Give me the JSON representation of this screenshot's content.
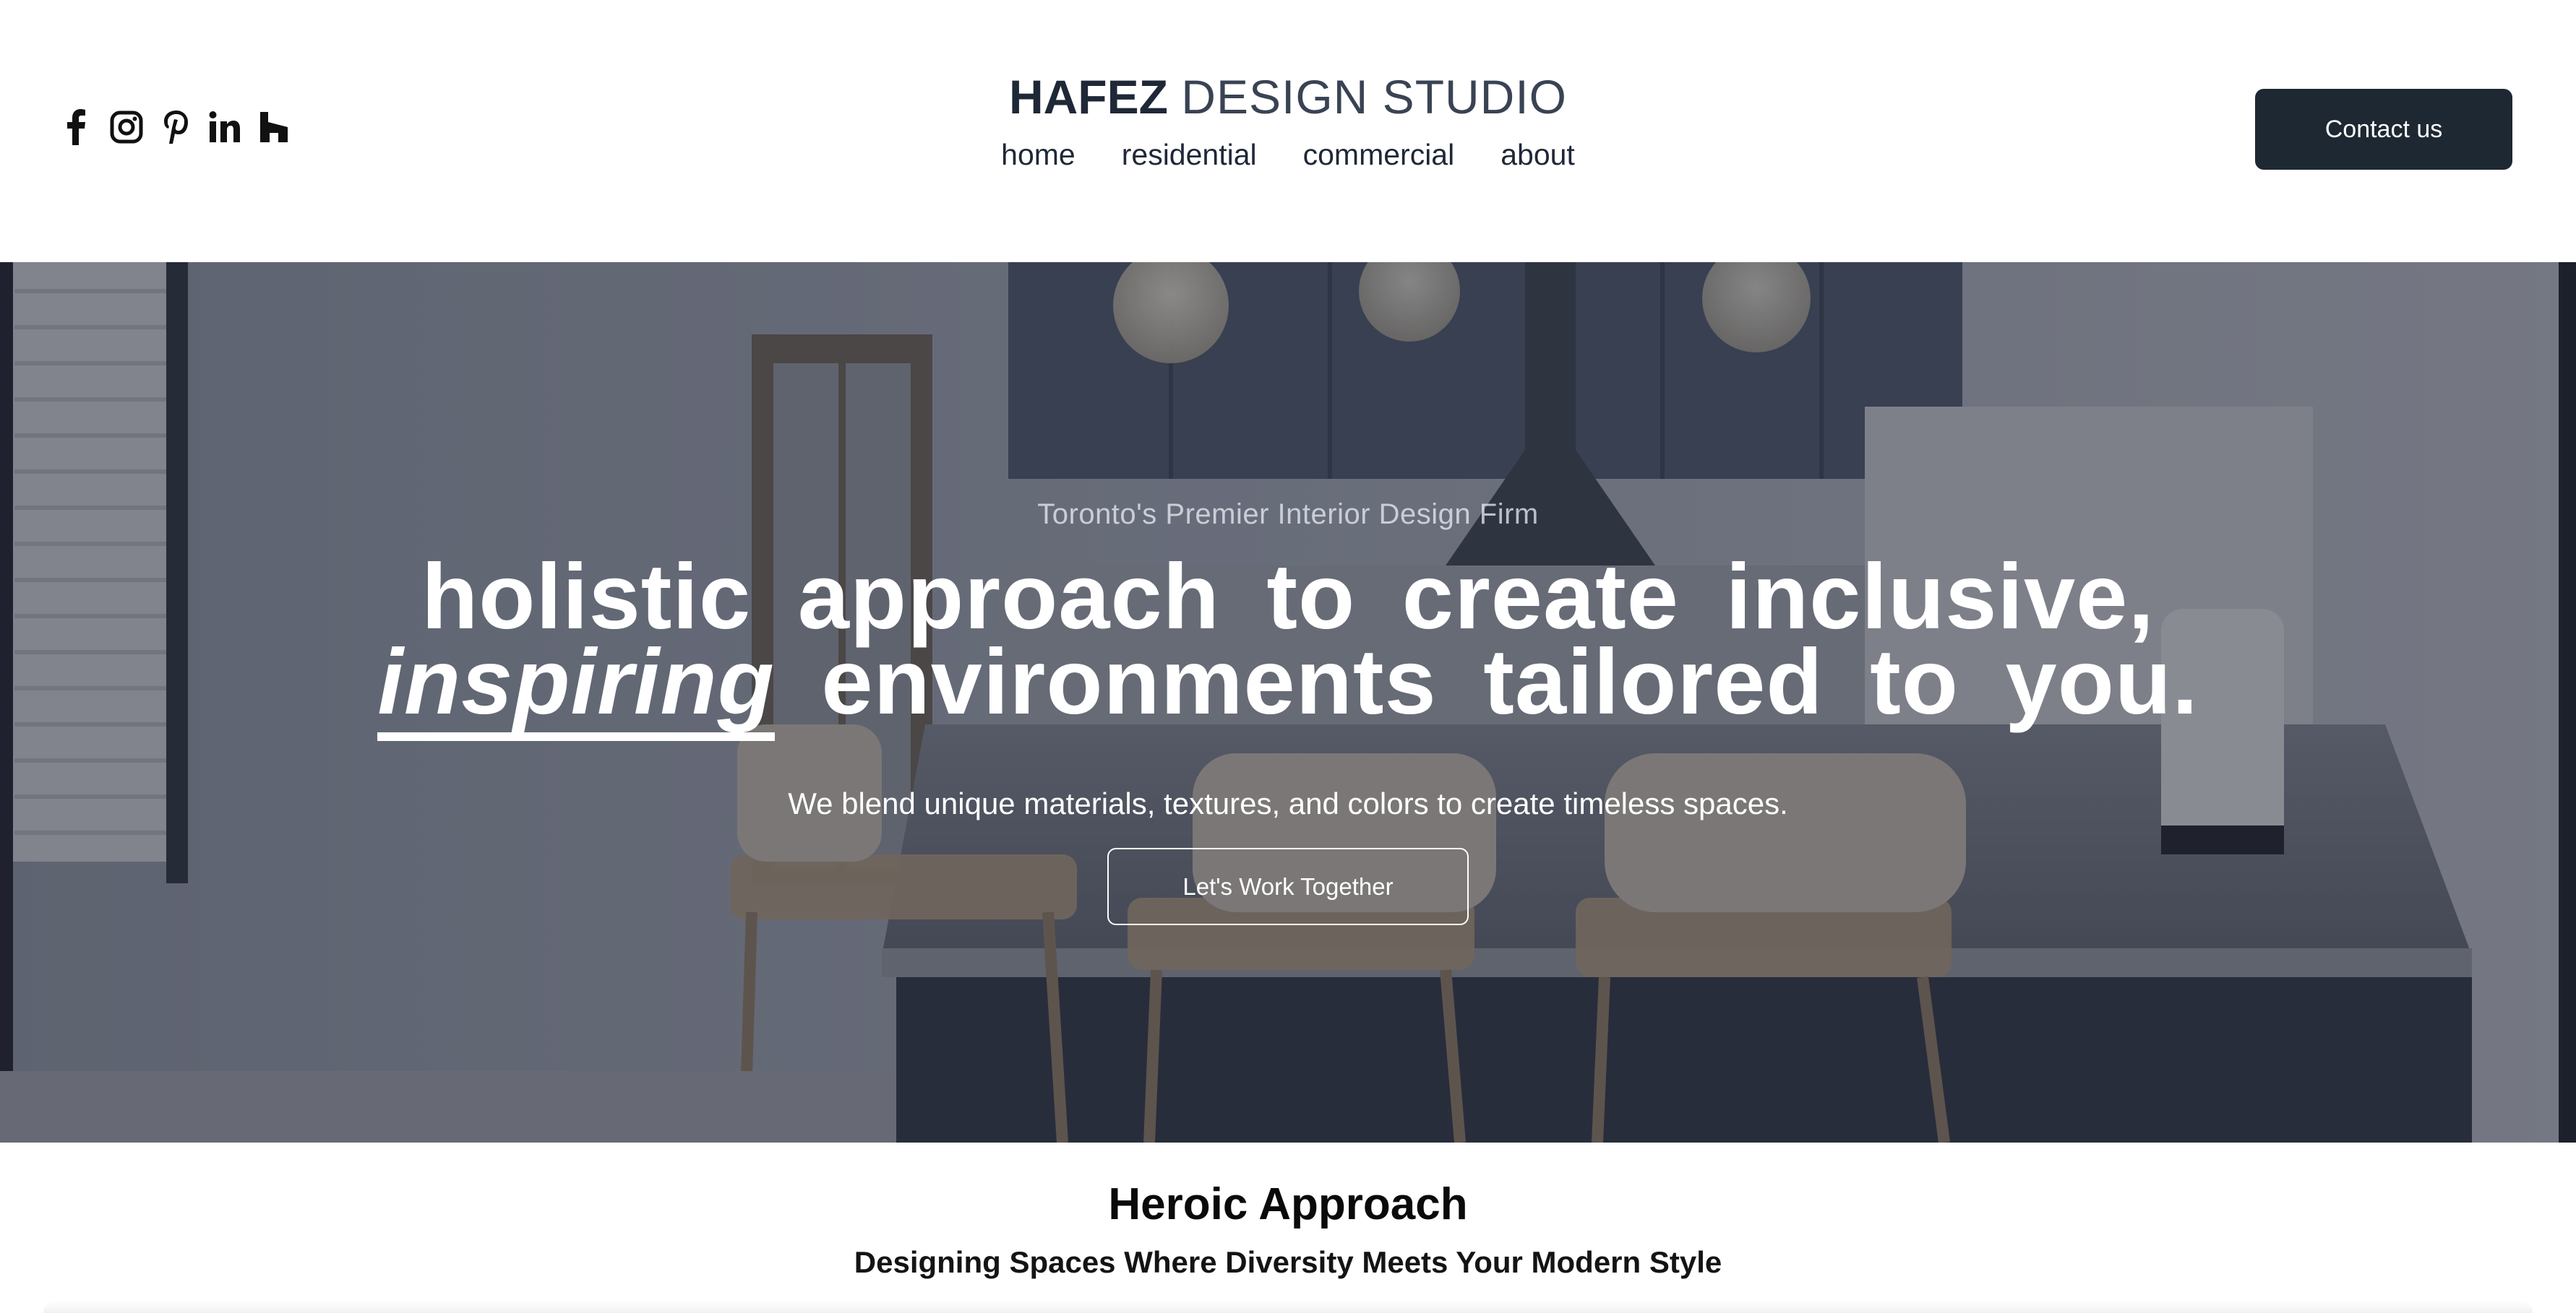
{
  "header": {
    "brand_bold": "HAFEZ",
    "brand_light": "DESIGN STUDIO",
    "nav": [
      {
        "label": "home"
      },
      {
        "label": "residential"
      },
      {
        "label": "commercial"
      },
      {
        "label": "about"
      }
    ],
    "contact_label": "Contact us",
    "social_icons": [
      "facebook-icon",
      "instagram-icon",
      "pinterest-icon",
      "linkedin-icon",
      "houzz-icon"
    ]
  },
  "hero": {
    "eyebrow": "Toronto's Premier Interior Design Firm",
    "headline_line1": "holistic approach to create inclusive,",
    "headline_accent": "inspiring",
    "headline_line2_rest": "environments tailored to you.",
    "subline": "We blend unique materials, textures, and colors to create timeless spaces.",
    "cta_label": "Let's Work Together"
  },
  "section": {
    "title": "Heroic Approach",
    "subtitle": "Designing Spaces Where Diversity Meets Your Modern Style"
  },
  "colors": {
    "text_dark": "#1f2837",
    "button_dark": "#1e2832",
    "hero_overlay": "#1e222e",
    "white": "#ffffff"
  }
}
